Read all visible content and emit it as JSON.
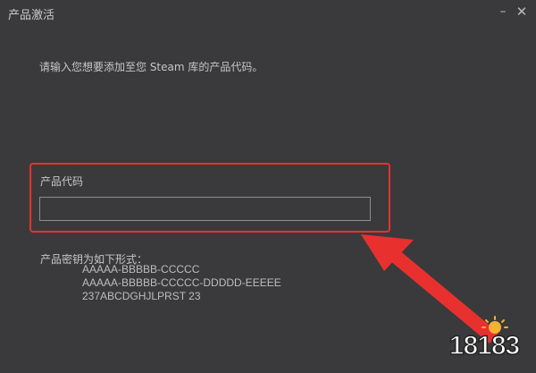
{
  "window": {
    "title": "产品激活",
    "minimize_glyph": "–",
    "close_glyph": "✕"
  },
  "prompt": "请输入您想要添加至您 Steam 库的产品代码。",
  "product_code": {
    "label": "产品代码",
    "value": ""
  },
  "format": {
    "label": "产品密钥为如下形式：",
    "examples": [
      "AAAAA-BBBBB-CCCCC",
      "AAAAA-BBBBB-CCCCC-DDDDD-EEEEE",
      "237ABCDGHJLPRST 23"
    ]
  },
  "annotation": {
    "highlight_color": "#e8312f",
    "arrow_color": "#e8312f"
  },
  "watermark": {
    "text": "18183"
  }
}
